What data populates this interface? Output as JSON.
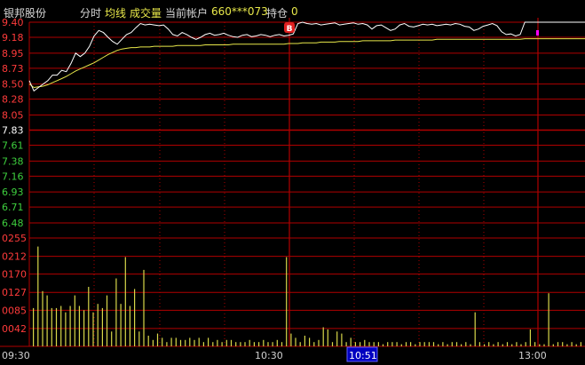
{
  "header": {
    "stock_name": "银邦股份",
    "mode": "分时",
    "avg_label": "均线",
    "vol_label": "成交量",
    "account_label": "当前帐户",
    "account_no": "660***073",
    "position_label": "持仓",
    "position_value": "0"
  },
  "price_axis": {
    "ticks": [
      "9.40",
      "9.18",
      "8.95",
      "8.73",
      "8.50",
      "8.28",
      "8.05",
      "7.83",
      "7.61",
      "7.38",
      "7.16",
      "6.93",
      "6.71",
      "6.48"
    ],
    "prev_close": "7.83"
  },
  "volume_axis": {
    "ticks": [
      "0255",
      "0212",
      "0170",
      "0127",
      "0085",
      "0042"
    ]
  },
  "time_axis": {
    "labels": [
      "09:30",
      "10:30",
      "10:51",
      "13:00"
    ],
    "cursor_label": "10:51"
  },
  "trade_marker": "B",
  "colors": {
    "background": "#000000",
    "grid": "#b00000",
    "up": "#ff3b3b",
    "down": "#3ecf3e",
    "price_line": "#ffffff",
    "avg_line": "#e8e84a",
    "volume_bar": "#d8d84a",
    "text": "#d0d0d0",
    "cursor_box": "#0000c0"
  },
  "chart_data": {
    "type": "line",
    "x_label_times": [
      "09:30",
      "10:30",
      "13:00"
    ],
    "ylim": [
      6.26,
      9.4
    ],
    "series": [
      {
        "values": [
          8.55,
          8.4,
          8.45,
          8.5,
          8.55,
          8.63,
          8.63,
          8.7,
          8.68,
          8.8,
          8.95,
          8.9,
          8.95,
          9.05,
          9.2,
          9.28,
          9.25,
          9.18,
          9.12,
          9.08,
          9.15,
          9.22,
          9.25,
          9.32,
          9.38,
          9.36,
          9.37,
          9.36,
          9.35,
          9.36,
          9.3,
          9.22,
          9.2,
          9.25,
          9.22,
          9.18,
          9.15,
          9.18,
          9.22,
          9.24,
          9.21,
          9.22,
          9.24,
          9.21,
          9.19,
          9.18,
          9.21,
          9.22,
          9.19,
          9.2,
          9.22,
          9.21,
          9.19,
          9.21,
          9.22,
          9.2,
          9.21,
          9.23,
          9.38,
          9.4,
          9.38,
          9.37,
          9.38,
          9.36,
          9.37,
          9.38,
          9.39,
          9.36,
          9.37,
          9.38,
          9.39,
          9.37,
          9.38,
          9.36,
          9.3,
          9.35,
          9.36,
          9.32,
          9.28,
          9.3,
          9.36,
          9.38,
          9.34,
          9.33,
          9.35,
          9.37,
          9.36,
          9.37,
          9.35,
          9.36,
          9.37,
          9.36,
          9.38,
          9.37,
          9.34,
          9.33,
          9.28,
          9.3,
          9.34,
          9.36,
          9.38,
          9.35,
          9.26,
          9.22,
          9.23,
          9.2,
          9.22,
          9.4,
          9.4,
          9.4,
          9.4,
          9.4,
          9.4,
          9.4,
          9.4,
          9.4,
          9.4,
          9.4,
          9.4,
          9.4,
          9.4
        ]
      },
      {
        "values": [
          8.5,
          8.45,
          8.46,
          8.47,
          8.49,
          8.52,
          8.55,
          8.58,
          8.61,
          8.65,
          8.69,
          8.72,
          8.75,
          8.78,
          8.81,
          8.85,
          8.89,
          8.93,
          8.96,
          8.99,
          9.01,
          9.02,
          9.03,
          9.03,
          9.04,
          9.04,
          9.04,
          9.05,
          9.05,
          9.05,
          9.05,
          9.05,
          9.06,
          9.06,
          9.06,
          9.06,
          9.06,
          9.06,
          9.07,
          9.07,
          9.07,
          9.07,
          9.07,
          9.07,
          9.08,
          9.08,
          9.08,
          9.08,
          9.08,
          9.08,
          9.08,
          9.08,
          9.08,
          9.08,
          9.08,
          9.08,
          9.09,
          9.09,
          9.09,
          9.1,
          9.1,
          9.1,
          9.1,
          9.11,
          9.11,
          9.11,
          9.11,
          9.12,
          9.12,
          9.12,
          9.12,
          9.12,
          9.13,
          9.13,
          9.13,
          9.13,
          9.13,
          9.13,
          9.13,
          9.14,
          9.14,
          9.14,
          9.14,
          9.14,
          9.14,
          9.14,
          9.14,
          9.14,
          9.15,
          9.15,
          9.15,
          9.15,
          9.15,
          9.15,
          9.15,
          9.15,
          9.15,
          9.15,
          9.15,
          9.15,
          9.15,
          9.15,
          9.15,
          9.15,
          9.15,
          9.15,
          9.15,
          9.16,
          9.16,
          9.16,
          9.16,
          9.16,
          9.16,
          9.16,
          9.16,
          9.16,
          9.16,
          9.16,
          9.16,
          9.16,
          9.16
        ]
      }
    ],
    "volume": {
      "ylim": [
        0,
        255
      ],
      "values": [
        90,
        235,
        130,
        120,
        90,
        90,
        95,
        80,
        95,
        120,
        95,
        85,
        140,
        80,
        100,
        90,
        120,
        35,
        160,
        100,
        210,
        95,
        135,
        35,
        180,
        25,
        15,
        30,
        20,
        10,
        20,
        20,
        15,
        15,
        20,
        15,
        20,
        10,
        20,
        10,
        15,
        10,
        15,
        15,
        10,
        10,
        10,
        15,
        10,
        10,
        15,
        10,
        10,
        15,
        10,
        210,
        30,
        20,
        10,
        25,
        20,
        10,
        15,
        45,
        40,
        10,
        35,
        30,
        10,
        20,
        10,
        10,
        15,
        10,
        10,
        10,
        5,
        10,
        10,
        10,
        5,
        10,
        10,
        5,
        10,
        10,
        10,
        10,
        5,
        10,
        5,
        10,
        10,
        5,
        10,
        5,
        80,
        10,
        5,
        10,
        5,
        10,
        5,
        10,
        5,
        10,
        5,
        10,
        40,
        10,
        5,
        5,
        125,
        5,
        10,
        10,
        5,
        10,
        5,
        10
      ]
    }
  }
}
